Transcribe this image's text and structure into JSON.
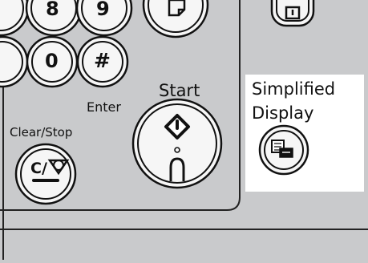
{
  "keys": {
    "eight": "8",
    "nine": "9",
    "zero": "0",
    "hash": "#",
    "enter_label": "Enter",
    "clear_stop_label": "Clear/Stop",
    "clear_stop_glyph": "C/"
  },
  "start": {
    "label": "Start"
  },
  "simplified_display": {
    "label_line1": "Simplified",
    "label_line2": "Display"
  },
  "colors": {
    "panel": "#c9cacc",
    "highlight": "#ffffff",
    "key_face": "#f6f6f6",
    "outline": "#111111"
  }
}
